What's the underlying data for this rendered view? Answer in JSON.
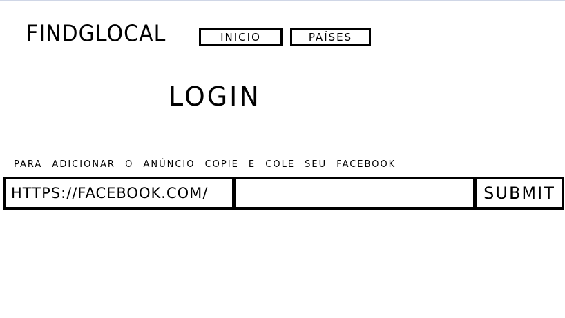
{
  "header": {
    "logo": "FINDGLOCAL",
    "nav": {
      "inicio": "INICIO",
      "paises": "PAÍSES"
    }
  },
  "main": {
    "title": "LOGIN",
    "instruction": "PARA ADICIONAR O ANÚNCIO COPIE E COLE SEU FACEBOOK",
    "form": {
      "url_prefix": "HTTPS://FACEBOOK.COM/",
      "input_value": "",
      "submit_label": "SUBMIT"
    }
  }
}
